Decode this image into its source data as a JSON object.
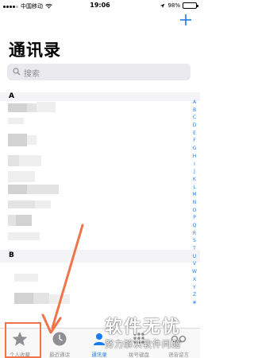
{
  "status_bar": {
    "carrier": "中国移动",
    "time": "19:06",
    "battery_percent": "98%",
    "battery_level": 0.98
  },
  "header": {
    "title": "通讯录",
    "add_icon": "plus-icon"
  },
  "search": {
    "placeholder": "搜索",
    "icon": "search-icon"
  },
  "sections": [
    {
      "label": "A"
    },
    {
      "label": "B"
    }
  ],
  "index_letters": [
    "A",
    "B",
    "C",
    "D",
    "E",
    "F",
    "G",
    "H",
    "I",
    "J",
    "K",
    "L",
    "M",
    "N",
    "O",
    "P",
    "Q",
    "R",
    "S",
    "T",
    "U",
    "V",
    "W",
    "X",
    "Y",
    "Z",
    "#"
  ],
  "tabbar": {
    "items": [
      {
        "label": "个人收藏",
        "icon": "star-icon",
        "active": false
      },
      {
        "label": "最近通话",
        "icon": "clock-icon",
        "active": false
      },
      {
        "label": "通讯录",
        "icon": "person-icon",
        "active": true
      },
      {
        "label": "拨号键盘",
        "icon": "keypad-icon",
        "active": false
      },
      {
        "label": "语音留言",
        "icon": "voicemail-icon",
        "active": false
      }
    ]
  },
  "watermark": {
    "title": "软件无忧",
    "subtitle": "努力解决软件问题"
  },
  "colors": {
    "accent": "#1a7cf5",
    "annotation": "#f0734a"
  }
}
